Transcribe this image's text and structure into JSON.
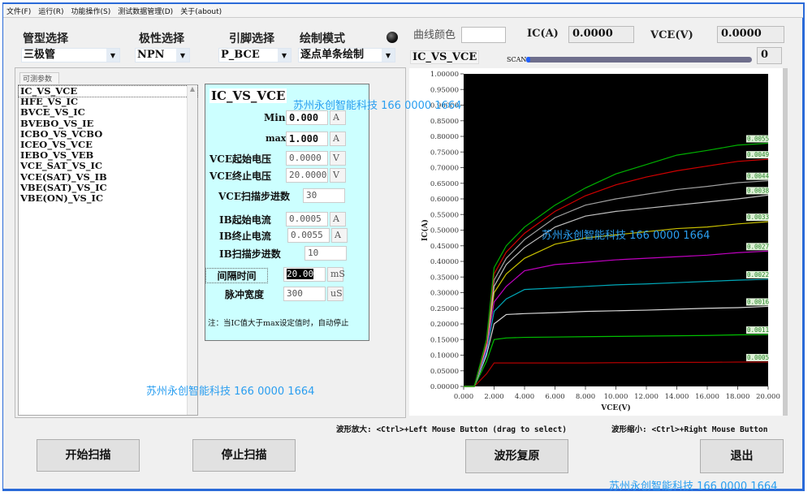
{
  "menu": [
    "文件(F)",
    "运行(R)",
    "功能操作(S)",
    "测试数据管理(D)",
    "关于(about)"
  ],
  "controls": {
    "tube_type": {
      "label": "管型选择",
      "value": "三极管"
    },
    "polarity": {
      "label": "极性选择",
      "value": "NPN"
    },
    "pins": {
      "label": "引脚选择",
      "value": "P_BCE"
    },
    "draw_mode": {
      "label": "绘制模式",
      "value": "逐点单条绘制"
    },
    "curve_color_label": "曲线颜色",
    "ic_label": "IC(A)",
    "ic_value": "0.0000",
    "vce_label": "VCE(V)",
    "vce_value": "0.0000",
    "chart_title": "IC_VS_VCE",
    "scan_label": "SCAN",
    "scan_value": "0",
    "scan_progress": 0
  },
  "params": {
    "tab": "可测参数",
    "items": [
      "IC_VS_VCE",
      "HFE_VS_IC",
      "BVCE_VS_IC",
      "BVEBO_VS_IE",
      "ICBO_VS_VCBO",
      "ICEO_VS_VCE",
      "IEBO_VS_VEB",
      "VCE_SAT_VS_IC",
      "VCE(SAT)_VS_IB",
      "VBE(SAT)_VS_IC",
      "VBE(ON)_VS_IC"
    ],
    "selected": 0
  },
  "settings": {
    "title": "IC_VS_VCE",
    "min": {
      "label": "Min",
      "value": "0.000",
      "unit": "A"
    },
    "max": {
      "label": "max",
      "value": "1.000",
      "unit": "A"
    },
    "vce_start": {
      "label": "VCE起始电压",
      "value": "0.0000",
      "unit": "V"
    },
    "vce_end": {
      "label": "VCE终止电压",
      "value": "20.0000",
      "unit": "V"
    },
    "vce_steps": {
      "label": "VCE扫描步进数",
      "value": "30"
    },
    "ib_start": {
      "label": "IB起始电流",
      "value": "0.0005",
      "unit": "A"
    },
    "ib_end": {
      "label": "IB终止电流",
      "value": "0.0055",
      "unit": "A"
    },
    "ib_steps": {
      "label": "IB扫描步进数",
      "value": "10"
    },
    "interval": {
      "label": "间隔时间",
      "value": "20.00",
      "unit": "mS"
    },
    "pulse": {
      "label": "脉冲宽度",
      "value": "300",
      "unit": "uS"
    },
    "note": "注：当IC值大于max设定值时，自动停止"
  },
  "hints": {
    "zoom_in": "波形放大: <Ctrl>+Left Mouse Button (drag to select)",
    "zoom_out": "波形缩小: <Ctrl>+Right Mouse Button"
  },
  "buttons": {
    "start": "开始扫描",
    "stop": "停止扫描",
    "restore": "波形复原",
    "exit": "退出"
  },
  "watermark": "苏州永创智能科技  166 0000 1664",
  "chart_data": {
    "type": "line",
    "xlabel": "VCE(V)",
    "ylabel": "IC(A)",
    "xlim": [
      0,
      20
    ],
    "ylim": [
      0,
      1
    ],
    "xticks": [
      "0.000",
      "2.000",
      "4.000",
      "6.000",
      "8.000",
      "10.000",
      "12.000",
      "14.000",
      "16.000",
      "18.000",
      "20.000"
    ],
    "yticks": [
      "0.00000",
      "0.05000",
      "0.10000",
      "0.15000",
      "0.20000",
      "0.25000",
      "0.30000",
      "0.35000",
      "0.40000",
      "0.45000",
      "0.50000",
      "0.55000",
      "0.60000",
      "0.65000",
      "0.70000",
      "0.75000",
      "0.80000",
      "0.85000",
      "0.90000",
      "0.95000",
      "1.00000"
    ],
    "background": "#000000",
    "grid": false,
    "x": [
      0,
      0.7,
      1.5,
      2,
      2.8,
      4,
      6,
      8,
      10,
      12,
      14,
      16,
      18,
      20
    ],
    "series": [
      {
        "name": "0.0005",
        "color": "#b00000",
        "values": [
          0,
          0,
          0.04,
          0.075,
          0.075,
          0.075,
          0.075,
          0.075,
          0.076,
          0.076,
          0.077,
          0.077,
          0.078,
          0.078
        ]
      },
      {
        "name": "0.0011",
        "color": "#00c000",
        "values": [
          0,
          0,
          0.08,
          0.15,
          0.155,
          0.157,
          0.158,
          0.159,
          0.16,
          0.161,
          0.162,
          0.163,
          0.165,
          0.166
        ]
      },
      {
        "name": "0.0016",
        "color": "#d8d8d8",
        "values": [
          0,
          0,
          0.1,
          0.2,
          0.23,
          0.233,
          0.236,
          0.24,
          0.242,
          0.244,
          0.247,
          0.25,
          0.252,
          0.256
        ]
      },
      {
        "name": "0.0022",
        "color": "#00a8b8",
        "values": [
          0,
          0,
          0.11,
          0.24,
          0.28,
          0.31,
          0.315,
          0.32,
          0.325,
          0.328,
          0.332,
          0.336,
          0.34,
          0.343
        ]
      },
      {
        "name": "0.0027",
        "color": "#c000c0",
        "values": [
          0,
          0,
          0.12,
          0.27,
          0.32,
          0.37,
          0.39,
          0.397,
          0.405,
          0.41,
          0.415,
          0.42,
          0.428,
          0.433
        ]
      },
      {
        "name": "0.0033",
        "color": "#c8c000",
        "values": [
          0,
          0,
          0.13,
          0.3,
          0.36,
          0.41,
          0.455,
          0.475,
          0.485,
          0.495,
          0.505,
          0.51,
          0.52,
          0.527
        ]
      },
      {
        "name": "0.0038",
        "color": "#c0c0c0",
        "values": [
          0,
          0,
          0.13,
          0.32,
          0.39,
          0.445,
          0.51,
          0.545,
          0.56,
          0.57,
          0.58,
          0.59,
          0.6,
          0.612
        ]
      },
      {
        "name": "0.0044",
        "color": "#a0a0a0",
        "values": [
          0,
          0,
          0.14,
          0.34,
          0.41,
          0.47,
          0.54,
          0.58,
          0.6,
          0.615,
          0.63,
          0.64,
          0.652,
          0.658
        ]
      },
      {
        "name": "0.0049",
        "color": "#d00000",
        "values": [
          0,
          0,
          0.14,
          0.36,
          0.43,
          0.49,
          0.56,
          0.61,
          0.645,
          0.67,
          0.69,
          0.705,
          0.72,
          0.727
        ]
      },
      {
        "name": "0.0055",
        "color": "#00b000",
        "values": [
          0,
          0,
          0.15,
          0.38,
          0.45,
          0.51,
          0.58,
          0.635,
          0.68,
          0.71,
          0.74,
          0.755,
          0.772,
          0.778
        ]
      }
    ]
  }
}
